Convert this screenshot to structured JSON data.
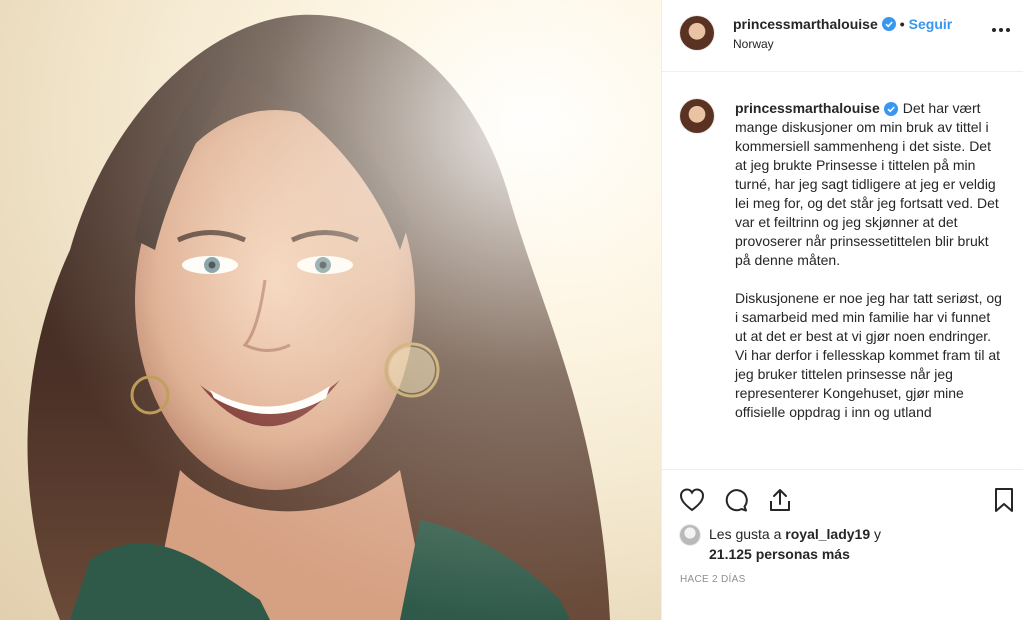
{
  "post": {
    "photo": {
      "description": "portrait of smiling woman with long wavy brown hair and gold hoop earrings"
    },
    "header": {
      "username": "princessmarthalouise",
      "separator": "•",
      "follow_label": "Seguir",
      "location": "Norway",
      "more_label": "•••"
    },
    "caption": {
      "username": "princessmarthalouise",
      "text": "Det har vært mange diskusjoner om min bruk av tittel i kommersiell sammenheng i det siste. Det at jeg brukte Prinsesse i tittelen på min turné, har jeg sagt tidligere at jeg er veldig lei meg for, og det står jeg fortsatt ved. Det var et feiltrinn og jeg skjønner at det provoserer når prinsessetittelen blir brukt på denne måten.\n\nDiskusjonene er noe jeg har tatt seriøst, og i samarbeid med min familie har vi funnet ut at det er best at vi gjør noen endringer.\nVi har derfor i fellesskap kommet fram til at jeg bruker tittelen prinsesse når jeg representerer Kongehuset, gjør mine offisielle oppdrag i inn og utland"
    },
    "likes": {
      "prefix": "Les gusta a ",
      "liker": "royal_lady19",
      "middle": " y ",
      "count": "21.125 personas más"
    },
    "timestamp": "HACE 2 DÍAS"
  },
  "colors": {
    "link_blue": "#3897f0",
    "text": "#262626",
    "muted": "#8e8e8e",
    "border": "#efefef"
  },
  "icons": [
    "verified-badge-icon",
    "more-options-icon",
    "heart-icon",
    "comment-icon",
    "share-icon",
    "bookmark-icon"
  ]
}
